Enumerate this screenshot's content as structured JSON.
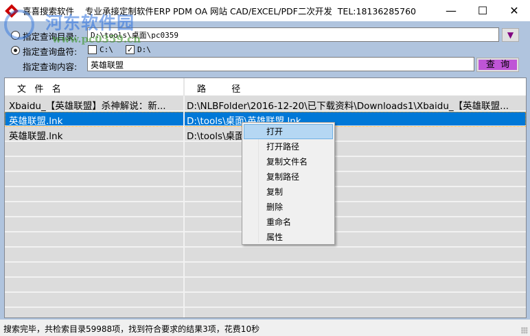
{
  "window": {
    "title": "喜喜搜索软件    专业承接定制软件ERP PDM OA 网站 CAD/EXCEL/PDF二次开发  TEL:18136285760",
    "min": "—",
    "max": "☐",
    "close": "✕"
  },
  "watermark": {
    "name": "河东软件园",
    "url": "www.pc0359.cn"
  },
  "form": {
    "dir_label": "指定查询目录:",
    "dir_value": "D:\\tools\\桌面\\pc0359",
    "dir_selected": false,
    "drive_label": "指定查询盘符:",
    "drive_selected": true,
    "drives": [
      {
        "label": "C:\\",
        "checked": false
      },
      {
        "label": "D:\\",
        "checked": true
      }
    ],
    "content_label": "指定查询内容:",
    "content_value": "英雄联盟",
    "dropdown_icon": "▼",
    "search_label": "查  询",
    "accent": "#bf55d6",
    "dropdown_color": "#800080"
  },
  "grid": {
    "headers": [
      "文   件   名",
      "路         径"
    ],
    "rows": [
      {
        "name": "Xbaidu_【英雄联盟】杀神解说：新...",
        "path": "D:\\NLBFolder\\2016-12-20\\已下载资料\\Downloads1\\Xbaidu_【英雄联盟..."
      },
      {
        "name": "英雄联盟.lnk",
        "path": "D:\\tools\\桌面\\英雄联盟.lnk",
        "selected": true
      },
      {
        "name": "英雄联盟.lnk",
        "path": "D:\\tools\\桌面\\英雄联盟.lnk"
      }
    ]
  },
  "context_menu": [
    "打开",
    "打开路径",
    "复制文件名",
    "复制路径",
    "复制",
    "删除",
    "重命名",
    "属性"
  ],
  "status": "搜索完毕，共检索目录59988项，找到符合要求的结果3项，花费10秒"
}
